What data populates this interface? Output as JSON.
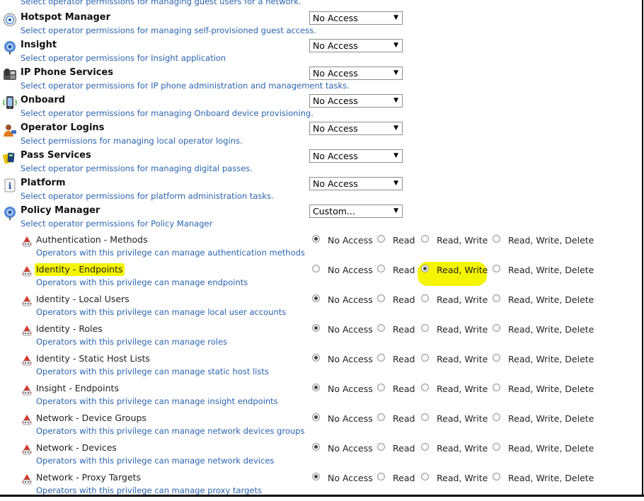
{
  "top_fragment": "Select operator permissions for managing guest users for a network.",
  "modules": [
    {
      "key": "hotspot",
      "icon": "hotspot-icon",
      "title": "Hotspot Manager",
      "desc": "Select operator permissions for managing self-provisioned guest access.",
      "select": "No Access"
    },
    {
      "key": "insight",
      "icon": "insight-icon",
      "title": "Insight",
      "desc": "Select operator permissions for Insight application",
      "select": "No Access"
    },
    {
      "key": "ipphone",
      "icon": "ip-phone-icon",
      "title": "IP Phone Services",
      "desc": "Select operator permissions for IP phone administration and management tasks.",
      "select": "No Access"
    },
    {
      "key": "onboard",
      "icon": "onboard-icon",
      "title": "Onboard",
      "desc": "Select operator permissions for managing Onboard device provisioning.",
      "select": "No Access"
    },
    {
      "key": "oplogins",
      "icon": "operator-logins-icon",
      "title": "Operator Logins",
      "desc": "Select permissions for managing local operator logins.",
      "select": "No Access"
    },
    {
      "key": "pass",
      "icon": "pass-services-icon",
      "title": "Pass Services",
      "desc": "Select operator permissions for managing digital passes.",
      "select": "No Access"
    },
    {
      "key": "platform",
      "icon": "platform-info-icon",
      "title": "Platform",
      "desc": "Select operator permissions for platform administration tasks.",
      "select": "No Access"
    },
    {
      "key": "policy",
      "icon": "policy-manager-icon",
      "title": "Policy Manager",
      "desc": "Select operator permissions for Policy Manager",
      "select": "Custom..."
    }
  ],
  "radio_options": [
    "No Access",
    "Read",
    "Read, Write",
    "Read, Write, Delete"
  ],
  "privileges": [
    {
      "label": "Authentication - Methods",
      "desc": "Operators with this privilege can manage authentication methods",
      "selected": "No Access",
      "highlight": false
    },
    {
      "label": "Identity - Endpoints",
      "desc": "Operators with this privilege can manage endpoints",
      "selected": "Read, Write",
      "highlight": true
    },
    {
      "label": "Identity - Local Users",
      "desc": "Operators with this privilege can manage local user accounts",
      "selected": "No Access",
      "highlight": false
    },
    {
      "label": "Identity - Roles",
      "desc": "Operators with this privilege can manage roles",
      "selected": "No Access",
      "highlight": false
    },
    {
      "label": "Identity - Static Host Lists",
      "desc": "Operators with this privilege can manage static host lists",
      "selected": "No Access",
      "highlight": false
    },
    {
      "label": "Insight - Endpoints",
      "desc": "Operators with this privilege can manage insight endpoints",
      "selected": "No Access",
      "highlight": false
    },
    {
      "label": "Network - Device Groups",
      "desc": "Operators with this privilege can manage network devices groups",
      "selected": "No Access",
      "highlight": false
    },
    {
      "label": "Network - Devices",
      "desc": "Operators with this privilege can manage network devices",
      "selected": "No Access",
      "highlight": false
    },
    {
      "label": "Network - Proxy Targets",
      "desc": "Operators with this privilege can manage proxy targets",
      "selected": "No Access",
      "highlight": false
    }
  ],
  "colors": {
    "link_blue": "#2a64b0",
    "highlight": "#f5f500"
  }
}
